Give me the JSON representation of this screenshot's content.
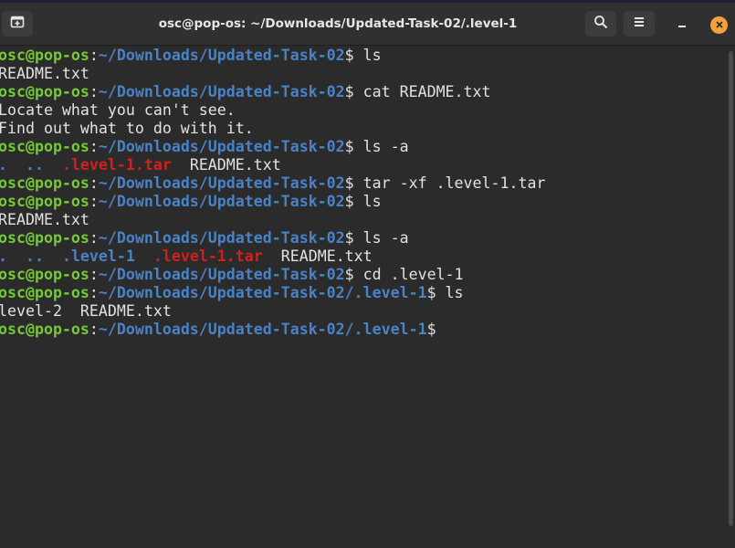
{
  "window": {
    "title": "osc@pop-os: ~/Downloads/Updated-Task-02/.level-1"
  },
  "icons": {
    "new_tab": "new-tab-icon",
    "search": "search-icon",
    "menu": "hamburger-menu-icon",
    "minimize": "minimize-icon",
    "close": "close-icon"
  },
  "colors": {
    "prompt_user": "#73c936",
    "prompt_path": "#4a82c6",
    "archive": "#d02020",
    "text": "#e2e2e2",
    "background": "#2b2b2b",
    "close_button": "#f6a03b"
  },
  "terminal": {
    "lines": [
      {
        "type": "prompt",
        "user": "osc@pop-os",
        "sep": ":",
        "path": "~/Downloads/Updated-Task-02",
        "sym": "$ ",
        "cmd": "ls"
      },
      {
        "type": "output",
        "parts": [
          {
            "text": "README.txt",
            "c": "white"
          }
        ]
      },
      {
        "type": "prompt",
        "user": "osc@pop-os",
        "sep": ":",
        "path": "~/Downloads/Updated-Task-02",
        "sym": "$ ",
        "cmd": "cat README.txt"
      },
      {
        "type": "output",
        "parts": [
          {
            "text": "Locate what you can't see.",
            "c": "white"
          }
        ]
      },
      {
        "type": "output",
        "parts": [
          {
            "text": "Find out what to do with it.",
            "c": "white"
          }
        ]
      },
      {
        "type": "prompt",
        "user": "osc@pop-os",
        "sep": ":",
        "path": "~/Downloads/Updated-Task-02",
        "sym": "$ ",
        "cmd": "ls -a"
      },
      {
        "type": "output",
        "parts": [
          {
            "text": ".",
            "c": "blue"
          },
          {
            "text": "  ",
            "c": "white"
          },
          {
            "text": "..",
            "c": "blue"
          },
          {
            "text": "  ",
            "c": "white"
          },
          {
            "text": ".level-1.tar",
            "c": "red"
          },
          {
            "text": "  README.txt",
            "c": "white"
          }
        ]
      },
      {
        "type": "prompt",
        "user": "osc@pop-os",
        "sep": ":",
        "path": "~/Downloads/Updated-Task-02",
        "sym": "$ ",
        "cmd": "tar -xf .level-1.tar"
      },
      {
        "type": "prompt",
        "user": "osc@pop-os",
        "sep": ":",
        "path": "~/Downloads/Updated-Task-02",
        "sym": "$ ",
        "cmd": "ls"
      },
      {
        "type": "output",
        "parts": [
          {
            "text": "README.txt",
            "c": "white"
          }
        ]
      },
      {
        "type": "prompt",
        "user": "osc@pop-os",
        "sep": ":",
        "path": "~/Downloads/Updated-Task-02",
        "sym": "$ ",
        "cmd": "ls -a"
      },
      {
        "type": "output",
        "parts": [
          {
            "text": ".",
            "c": "blue"
          },
          {
            "text": "  ",
            "c": "white"
          },
          {
            "text": "..",
            "c": "blue"
          },
          {
            "text": "  ",
            "c": "white"
          },
          {
            "text": ".level-1",
            "c": "blue"
          },
          {
            "text": "  ",
            "c": "white"
          },
          {
            "text": ".level-1.tar",
            "c": "red"
          },
          {
            "text": "  README.txt",
            "c": "white"
          }
        ]
      },
      {
        "type": "prompt",
        "user": "osc@pop-os",
        "sep": ":",
        "path": "~/Downloads/Updated-Task-02",
        "sym": "$ ",
        "cmd": "cd .level-1"
      },
      {
        "type": "prompt",
        "user": "osc@pop-os",
        "sep": ":",
        "path": "~/Downloads/Updated-Task-02/.level-1",
        "sym": "$ ",
        "cmd": "ls"
      },
      {
        "type": "output",
        "parts": [
          {
            "text": "level-2  README.txt",
            "c": "white"
          }
        ]
      },
      {
        "type": "prompt",
        "user": "osc@pop-os",
        "sep": ":",
        "path": "~/Downloads/Updated-Task-02/.level-1",
        "sym": "$",
        "cmd": ""
      }
    ]
  }
}
